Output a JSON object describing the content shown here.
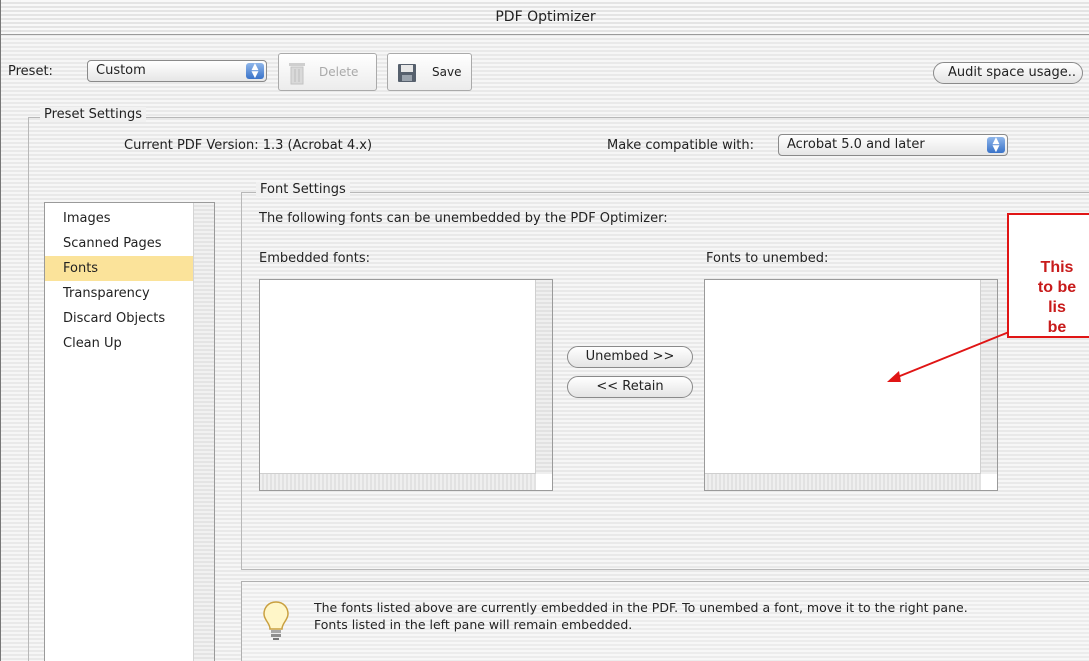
{
  "window": {
    "title": "PDF Optimizer"
  },
  "toolbar": {
    "preset_label": "Preset:",
    "preset_value": "Custom",
    "delete_label": "Delete",
    "save_label": "Save",
    "audit_label": "Audit space usage.."
  },
  "preset_settings": {
    "legend": "Preset Settings",
    "current_version": "Current PDF Version: 1.3 (Acrobat 4.x)",
    "compat_label": "Make compatible with:",
    "compat_value": "Acrobat 5.0 and later"
  },
  "sidebar": {
    "items": [
      {
        "label": "Images"
      },
      {
        "label": "Scanned Pages"
      },
      {
        "label": "Fonts"
      },
      {
        "label": "Transparency"
      },
      {
        "label": "Discard Objects"
      },
      {
        "label": "Clean Up"
      }
    ],
    "selected": "Fonts"
  },
  "font_settings": {
    "legend": "Font Settings",
    "intro": "The following fonts can be unembedded by the PDF Optimizer:",
    "embedded_label": "Embedded fonts:",
    "unembed_label": "Fonts to unembed:",
    "unembed_button": "Unembed >>",
    "retain_button": "<< Retain"
  },
  "info": {
    "line1": "The fonts listed above are currently embedded in the PDF. To unembed a font, move it to the right pane.",
    "line2": "Fonts listed in the left pane will remain embedded."
  },
  "callout": {
    "lines": [
      "This",
      "to be",
      "lis",
      "be"
    ]
  },
  "colors": {
    "accent": "#3a73c9",
    "selection": "#fbe39a",
    "callout": "#e01515"
  }
}
